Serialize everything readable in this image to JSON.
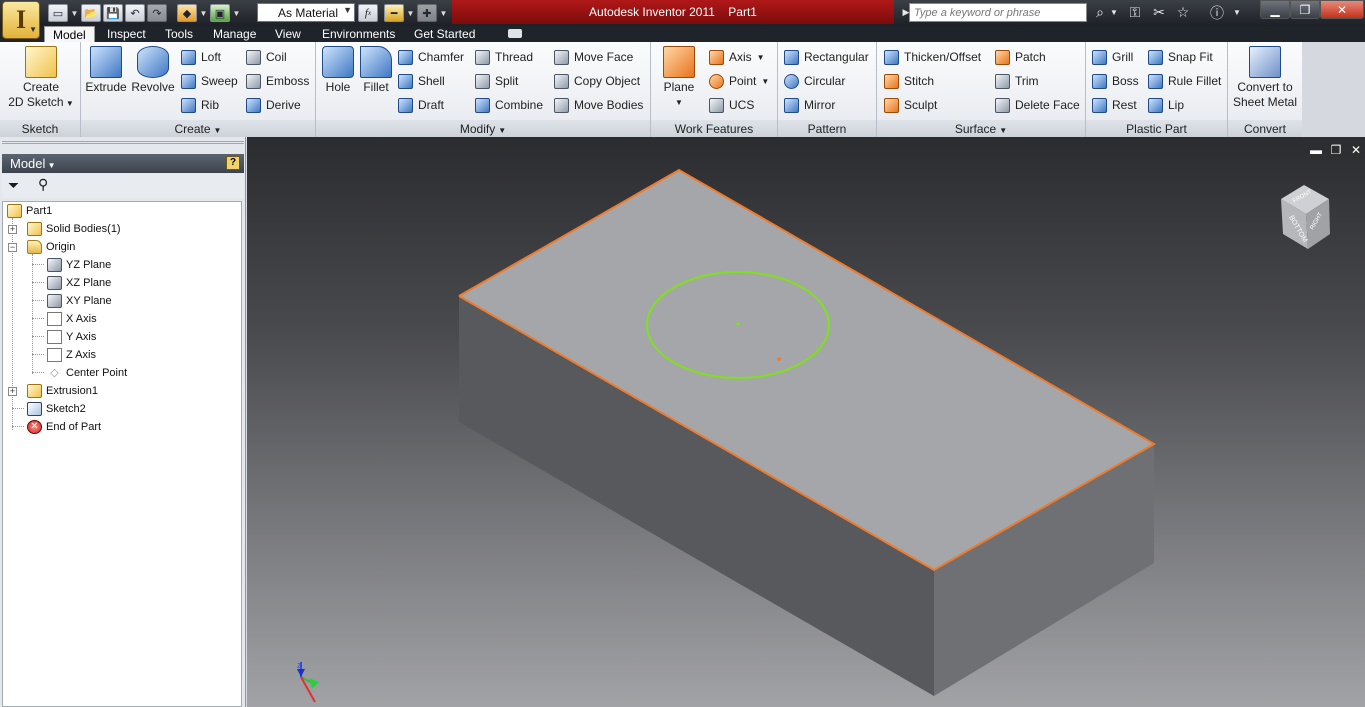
{
  "app": {
    "title": "Autodesk Inventor 2011",
    "document": "Part1"
  },
  "toolbar": {
    "material": "As Material"
  },
  "search": {
    "placeholder": "Type a keyword or phrase"
  },
  "tabs": [
    "Model",
    "Inspect",
    "Tools",
    "Manage",
    "View",
    "Environments",
    "Get Started"
  ],
  "ribbon": {
    "sketch": {
      "label": "Sketch",
      "create_sketch": "Create",
      "create_sketch_2": "2D Sketch"
    },
    "create": {
      "label": "Create",
      "extrude": "Extrude",
      "revolve": "Revolve",
      "loft": "Loft",
      "sweep": "Sweep",
      "rib": "Rib",
      "coil": "Coil",
      "emboss": "Emboss",
      "derive": "Derive"
    },
    "modify": {
      "label": "Modify",
      "hole": "Hole",
      "fillet": "Fillet",
      "chamfer": "Chamfer",
      "shell": "Shell",
      "draft": "Draft",
      "thread": "Thread",
      "split": "Split",
      "combine": "Combine",
      "move_face": "Move Face",
      "copy_object": "Copy Object",
      "move_bodies": "Move Bodies"
    },
    "work": {
      "label": "Work Features",
      "plane": "Plane",
      "axis": "Axis",
      "point": "Point",
      "ucs": "UCS"
    },
    "pattern": {
      "label": "Pattern",
      "rectangular": "Rectangular",
      "circular": "Circular",
      "mirror": "Mirror"
    },
    "surface": {
      "label": "Surface",
      "thicken": "Thicken/Offset",
      "stitch": "Stitch",
      "sculpt": "Sculpt",
      "patch": "Patch",
      "trim": "Trim",
      "delete_face": "Delete Face"
    },
    "plastic": {
      "label": "Plastic Part",
      "grill": "Grill",
      "boss": "Boss",
      "rest": "Rest",
      "snap_fit": "Snap Fit",
      "rule_fillet": "Rule Fillet",
      "lip": "Lip"
    },
    "convert": {
      "label": "Convert",
      "btn": "Convert to",
      "btn2": "Sheet Metal"
    }
  },
  "browser": {
    "title": "Model",
    "nodes": [
      "Part1",
      "Solid Bodies(1)",
      "Origin",
      "YZ Plane",
      "XZ Plane",
      "XY Plane",
      "X Axis",
      "Y Axis",
      "Z Axis",
      "Center Point",
      "Extrusion1",
      "Sketch2",
      "End of Part"
    ]
  },
  "viewcube": {
    "labels": [
      "FRONT",
      "BOTTOM",
      "RIGHT"
    ]
  },
  "colors": {
    "title_red": "#9e1414",
    "edge_highlight": "#f07a2a",
    "sketch_circle": "#7fe01c"
  }
}
